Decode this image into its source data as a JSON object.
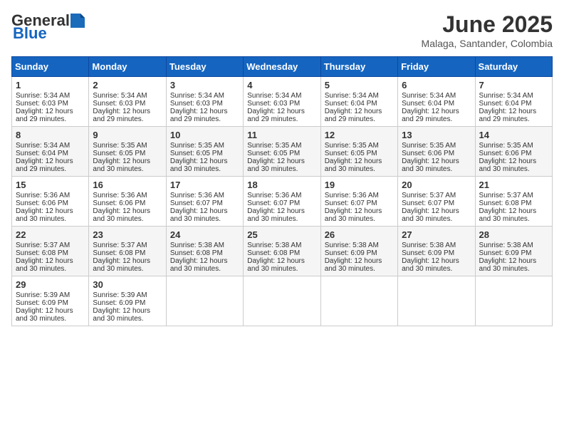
{
  "header": {
    "logo_general": "General",
    "logo_blue": "Blue",
    "month_title": "June 2025",
    "location": "Malaga, Santander, Colombia"
  },
  "days_of_week": [
    "Sunday",
    "Monday",
    "Tuesday",
    "Wednesday",
    "Thursday",
    "Friday",
    "Saturday"
  ],
  "weeks": [
    [
      {
        "day": "1",
        "sunrise": "Sunrise: 5:34 AM",
        "sunset": "Sunset: 6:03 PM",
        "daylight": "Daylight: 12 hours and 29 minutes."
      },
      {
        "day": "2",
        "sunrise": "Sunrise: 5:34 AM",
        "sunset": "Sunset: 6:03 PM",
        "daylight": "Daylight: 12 hours and 29 minutes."
      },
      {
        "day": "3",
        "sunrise": "Sunrise: 5:34 AM",
        "sunset": "Sunset: 6:03 PM",
        "daylight": "Daylight: 12 hours and 29 minutes."
      },
      {
        "day": "4",
        "sunrise": "Sunrise: 5:34 AM",
        "sunset": "Sunset: 6:03 PM",
        "daylight": "Daylight: 12 hours and 29 minutes."
      },
      {
        "day": "5",
        "sunrise": "Sunrise: 5:34 AM",
        "sunset": "Sunset: 6:04 PM",
        "daylight": "Daylight: 12 hours and 29 minutes."
      },
      {
        "day": "6",
        "sunrise": "Sunrise: 5:34 AM",
        "sunset": "Sunset: 6:04 PM",
        "daylight": "Daylight: 12 hours and 29 minutes."
      },
      {
        "day": "7",
        "sunrise": "Sunrise: 5:34 AM",
        "sunset": "Sunset: 6:04 PM",
        "daylight": "Daylight: 12 hours and 29 minutes."
      }
    ],
    [
      {
        "day": "8",
        "sunrise": "Sunrise: 5:34 AM",
        "sunset": "Sunset: 6:04 PM",
        "daylight": "Daylight: 12 hours and 29 minutes."
      },
      {
        "day": "9",
        "sunrise": "Sunrise: 5:35 AM",
        "sunset": "Sunset: 6:05 PM",
        "daylight": "Daylight: 12 hours and 30 minutes."
      },
      {
        "day": "10",
        "sunrise": "Sunrise: 5:35 AM",
        "sunset": "Sunset: 6:05 PM",
        "daylight": "Daylight: 12 hours and 30 minutes."
      },
      {
        "day": "11",
        "sunrise": "Sunrise: 5:35 AM",
        "sunset": "Sunset: 6:05 PM",
        "daylight": "Daylight: 12 hours and 30 minutes."
      },
      {
        "day": "12",
        "sunrise": "Sunrise: 5:35 AM",
        "sunset": "Sunset: 6:05 PM",
        "daylight": "Daylight: 12 hours and 30 minutes."
      },
      {
        "day": "13",
        "sunrise": "Sunrise: 5:35 AM",
        "sunset": "Sunset: 6:06 PM",
        "daylight": "Daylight: 12 hours and 30 minutes."
      },
      {
        "day": "14",
        "sunrise": "Sunrise: 5:35 AM",
        "sunset": "Sunset: 6:06 PM",
        "daylight": "Daylight: 12 hours and 30 minutes."
      }
    ],
    [
      {
        "day": "15",
        "sunrise": "Sunrise: 5:36 AM",
        "sunset": "Sunset: 6:06 PM",
        "daylight": "Daylight: 12 hours and 30 minutes."
      },
      {
        "day": "16",
        "sunrise": "Sunrise: 5:36 AM",
        "sunset": "Sunset: 6:06 PM",
        "daylight": "Daylight: 12 hours and 30 minutes."
      },
      {
        "day": "17",
        "sunrise": "Sunrise: 5:36 AM",
        "sunset": "Sunset: 6:07 PM",
        "daylight": "Daylight: 12 hours and 30 minutes."
      },
      {
        "day": "18",
        "sunrise": "Sunrise: 5:36 AM",
        "sunset": "Sunset: 6:07 PM",
        "daylight": "Daylight: 12 hours and 30 minutes."
      },
      {
        "day": "19",
        "sunrise": "Sunrise: 5:36 AM",
        "sunset": "Sunset: 6:07 PM",
        "daylight": "Daylight: 12 hours and 30 minutes."
      },
      {
        "day": "20",
        "sunrise": "Sunrise: 5:37 AM",
        "sunset": "Sunset: 6:07 PM",
        "daylight": "Daylight: 12 hours and 30 minutes."
      },
      {
        "day": "21",
        "sunrise": "Sunrise: 5:37 AM",
        "sunset": "Sunset: 6:08 PM",
        "daylight": "Daylight: 12 hours and 30 minutes."
      }
    ],
    [
      {
        "day": "22",
        "sunrise": "Sunrise: 5:37 AM",
        "sunset": "Sunset: 6:08 PM",
        "daylight": "Daylight: 12 hours and 30 minutes."
      },
      {
        "day": "23",
        "sunrise": "Sunrise: 5:37 AM",
        "sunset": "Sunset: 6:08 PM",
        "daylight": "Daylight: 12 hours and 30 minutes."
      },
      {
        "day": "24",
        "sunrise": "Sunrise: 5:38 AM",
        "sunset": "Sunset: 6:08 PM",
        "daylight": "Daylight: 12 hours and 30 minutes."
      },
      {
        "day": "25",
        "sunrise": "Sunrise: 5:38 AM",
        "sunset": "Sunset: 6:08 PM",
        "daylight": "Daylight: 12 hours and 30 minutes."
      },
      {
        "day": "26",
        "sunrise": "Sunrise: 5:38 AM",
        "sunset": "Sunset: 6:09 PM",
        "daylight": "Daylight: 12 hours and 30 minutes."
      },
      {
        "day": "27",
        "sunrise": "Sunrise: 5:38 AM",
        "sunset": "Sunset: 6:09 PM",
        "daylight": "Daylight: 12 hours and 30 minutes."
      },
      {
        "day": "28",
        "sunrise": "Sunrise: 5:38 AM",
        "sunset": "Sunset: 6:09 PM",
        "daylight": "Daylight: 12 hours and 30 minutes."
      }
    ],
    [
      {
        "day": "29",
        "sunrise": "Sunrise: 5:39 AM",
        "sunset": "Sunset: 6:09 PM",
        "daylight": "Daylight: 12 hours and 30 minutes."
      },
      {
        "day": "30",
        "sunrise": "Sunrise: 5:39 AM",
        "sunset": "Sunset: 6:09 PM",
        "daylight": "Daylight: 12 hours and 30 minutes."
      },
      {
        "day": "",
        "sunrise": "",
        "sunset": "",
        "daylight": ""
      },
      {
        "day": "",
        "sunrise": "",
        "sunset": "",
        "daylight": ""
      },
      {
        "day": "",
        "sunrise": "",
        "sunset": "",
        "daylight": ""
      },
      {
        "day": "",
        "sunrise": "",
        "sunset": "",
        "daylight": ""
      },
      {
        "day": "",
        "sunrise": "",
        "sunset": "",
        "daylight": ""
      }
    ]
  ]
}
